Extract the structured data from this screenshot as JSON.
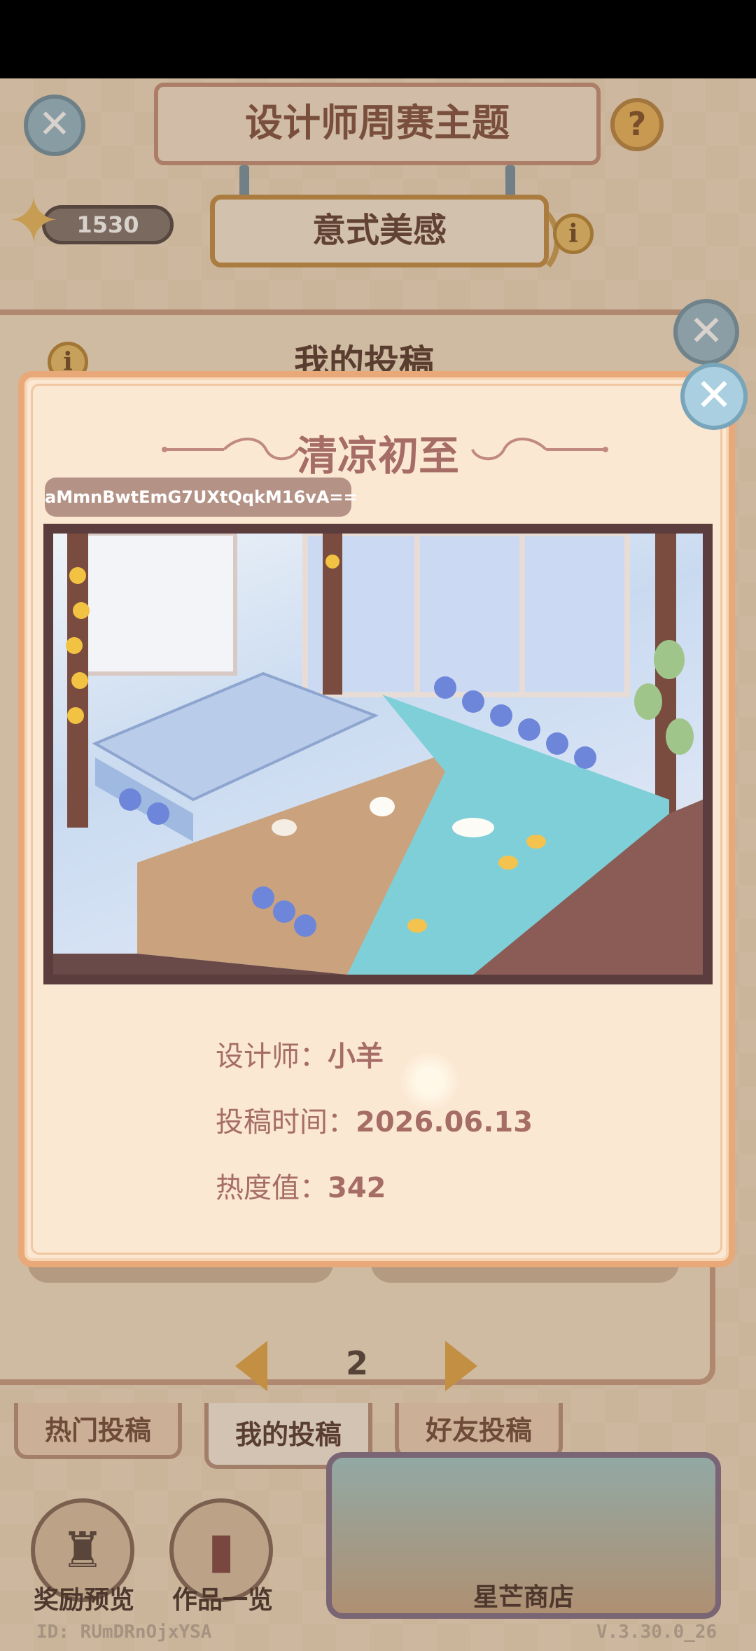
{
  "header": {
    "title": "设计师周赛主题",
    "subtitle": "意式美感",
    "star_count": "1530",
    "help_glyph": "?",
    "close_glyph": "✕",
    "info_glyph": "i"
  },
  "panel": {
    "title": "我的投稿",
    "page_number": "2"
  },
  "tabs": [
    {
      "label": "热门投稿",
      "active": false
    },
    {
      "label": "我的投稿",
      "active": true
    },
    {
      "label": "好友投稿",
      "active": false
    }
  ],
  "bottom": {
    "reward_label": "奖励预览",
    "works_label": "作品一览",
    "shop_label": "星芒商店",
    "player_id": "ID: RUmDRnOjxYSA",
    "version": "V.3.30.0_26"
  },
  "popup": {
    "title": "清凉初至",
    "code": "aMmnBwtEmG7UXtQqkM16vA==",
    "designer_label": "设计师：",
    "designer_name": "小羊",
    "time_label": "投稿时间：",
    "time_value": "2026.06.13",
    "heat_label": "热度值：",
    "heat_value": "342",
    "close_glyph": "✕"
  },
  "colors": {
    "accent_brown": "#a56d66",
    "panel_border": "#c79a82",
    "popup_border": "#e8a877",
    "close_blue": "#93b8cb",
    "arrow_gold": "#e0a443"
  }
}
